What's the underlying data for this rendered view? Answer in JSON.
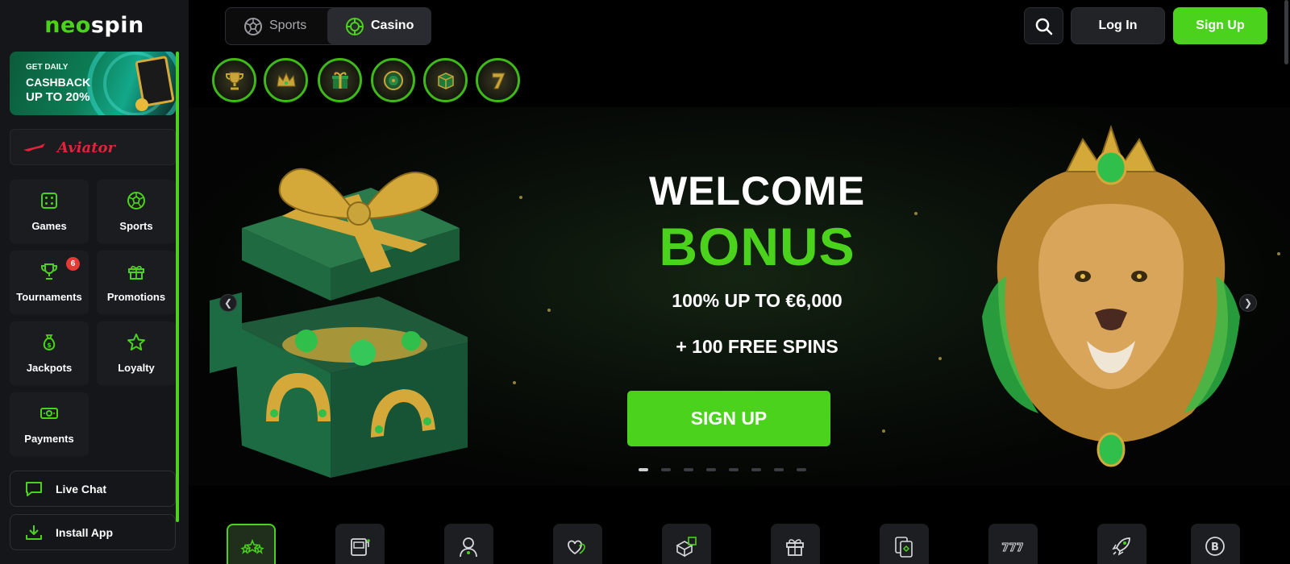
{
  "brand": {
    "logo_part1": "neo",
    "logo_part2": "spin",
    "accent": "#4bd21c"
  },
  "promo_banner": {
    "line1": "GET DAILY",
    "line2": "CASHBACK",
    "line3": "UP TO 20%"
  },
  "aviator": {
    "label": "Aviator"
  },
  "sidebar": {
    "tiles": [
      {
        "label": "Games",
        "icon": "dice-icon"
      },
      {
        "label": "Sports",
        "icon": "soccer-ball-icon"
      },
      {
        "label": "Tournaments",
        "icon": "trophy-icon",
        "badge": "6"
      },
      {
        "label": "Promotions",
        "icon": "gift-icon"
      },
      {
        "label": "Jackpots",
        "icon": "money-bag-icon"
      },
      {
        "label": "Loyalty",
        "icon": "star-icon"
      },
      {
        "label": "Payments",
        "icon": "cash-icon"
      }
    ],
    "live_chat": "Live Chat",
    "install_app": "Install App"
  },
  "header": {
    "tabs": [
      {
        "label": "Sports",
        "icon": "soccer-ball-icon"
      },
      {
        "label": "Casino",
        "icon": "casino-chip-icon",
        "active": true
      }
    ],
    "login": "Log In",
    "signup": "Sign Up"
  },
  "quick_chips": [
    "trophy-chip",
    "crown-chip",
    "gift-chip",
    "wheel-chip",
    "box-chip",
    "seven-chip"
  ],
  "hero": {
    "title_line1": "WELCOME",
    "title_line2": "BONUS",
    "offer": "100% UP TO €6,000",
    "spins": "+ 100 FREE SPINS",
    "cta": "SIGN UP",
    "slides_total": 8,
    "active_slide": 1
  },
  "categories": [
    "stars-icon",
    "slot-machine-icon",
    "live-dealer-icon",
    "hearts-icon",
    "dice-icon",
    "gift-icon",
    "cards-icon",
    "sevens-icon",
    "rocket-icon",
    "bitcoin-icon"
  ]
}
